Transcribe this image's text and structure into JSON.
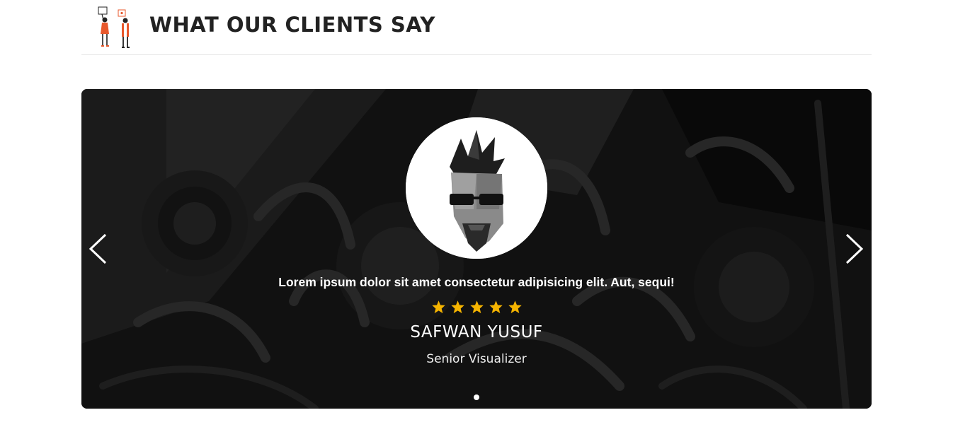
{
  "section": {
    "title": "WHAT OUR CLIENTS SAY"
  },
  "testimonial": {
    "quote": "Lorem ipsum dolor sit amet consectetur adipisicing elit. Aut, sequi!",
    "rating": 5,
    "name": "SAFWAN YUSUF",
    "role": "Senior Visualizer"
  },
  "slider": {
    "total_slides": 1,
    "active_slide": 1
  },
  "icons": {
    "prev": "chevron-left-icon",
    "next": "chevron-right-icon",
    "star": "star-icon",
    "header_illustration": "people-holding-signs-illustration"
  },
  "colors": {
    "title": "#222222",
    "star": "#f5b400",
    "accent": "#e8582c",
    "text_on_dark": "#ffffff"
  }
}
